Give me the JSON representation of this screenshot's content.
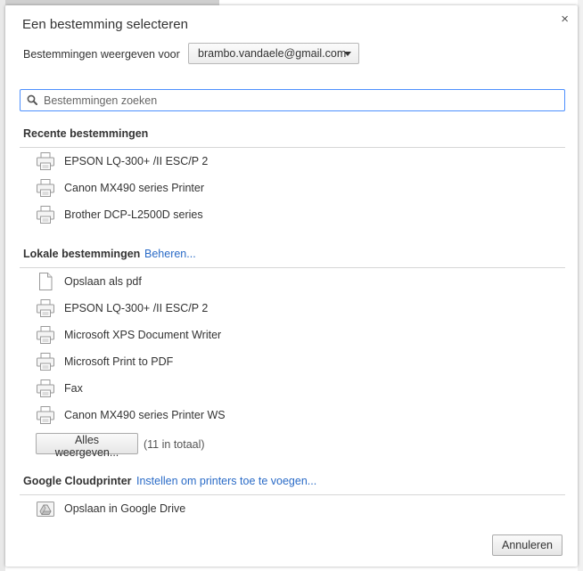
{
  "dialog": {
    "title": "Een bestemming selecteren",
    "close_label": "×"
  },
  "account": {
    "label": "Bestemmingen weergeven voor",
    "value": "brambo.vandaele@gmail.com"
  },
  "search": {
    "placeholder": "Bestemmingen zoeken",
    "icon": "search-icon"
  },
  "recent": {
    "heading": "Recente bestemmingen",
    "items": [
      {
        "label": "EPSON LQ-300+ /II ESC/P 2",
        "icon": "printer-icon"
      },
      {
        "label": "Canon MX490 series Printer",
        "icon": "printer-icon"
      },
      {
        "label": "Brother DCP-L2500D series",
        "icon": "printer-icon"
      }
    ]
  },
  "local": {
    "heading": "Lokale bestemmingen",
    "manage_link": "Beheren...",
    "items": [
      {
        "label": "Opslaan als pdf",
        "icon": "document-icon"
      },
      {
        "label": "EPSON LQ-300+ /II ESC/P 2",
        "icon": "printer-icon"
      },
      {
        "label": "Microsoft XPS Document Writer",
        "icon": "printer-icon"
      },
      {
        "label": "Microsoft Print to PDF",
        "icon": "printer-icon"
      },
      {
        "label": "Fax",
        "icon": "printer-icon"
      },
      {
        "label": "Canon MX490 series Printer WS",
        "icon": "printer-icon"
      }
    ],
    "show_all_button": "Alles weergeven...",
    "total_text": "(11 in totaal)"
  },
  "cloud": {
    "heading": "Google Cloudprinter",
    "setup_link": "Instellen om printers toe te voegen...",
    "items": [
      {
        "label": "Opslaan in Google Drive",
        "icon": "google-drive-icon"
      }
    ]
  },
  "footer": {
    "cancel_button": "Annuleren"
  },
  "colors": {
    "link": "#2a6bc7",
    "search_focus_border": "#4d90fe",
    "divider": "#d6d6d6"
  }
}
